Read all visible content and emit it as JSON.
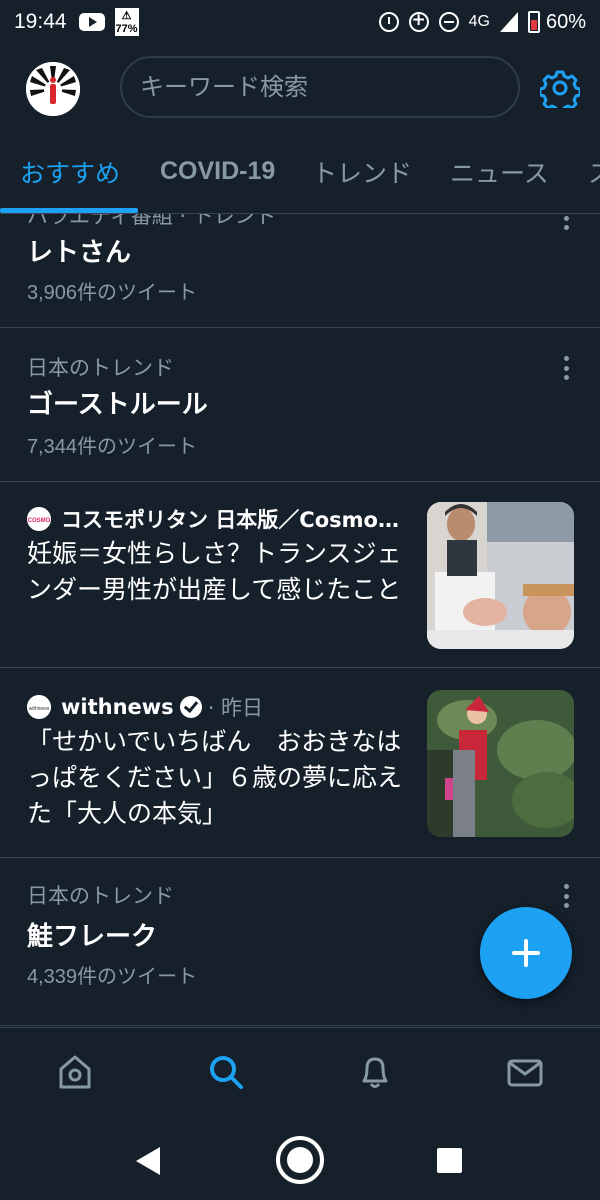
{
  "status_bar": {
    "time": "19:44",
    "sd_badge_top": "⚠",
    "sd_badge_pct": "77%",
    "network": "4G",
    "battery_pct": "60%"
  },
  "header": {
    "search_placeholder": "キーワード検索"
  },
  "tabs": [
    {
      "label": "おすすめ",
      "active": true
    },
    {
      "label": "COVID-19",
      "active": false
    },
    {
      "label": "トレンド",
      "active": false
    },
    {
      "label": "ニュース",
      "active": false
    },
    {
      "label": "ス",
      "active": false
    }
  ],
  "feed": {
    "trend1": {
      "context": "バラエティ番組 · トレンド",
      "topic": "レトさん",
      "count": "3,906件のツイート"
    },
    "trend2": {
      "context": "日本のトレンド",
      "topic": "ゴーストルール",
      "count": "7,344件のツイート"
    },
    "news1": {
      "source": "コスモポリタン 日本版／Cosmop...",
      "logo_text": "COSMO",
      "headline": "妊娠＝女性らしさ？トランスジェンダー男性が出産して感じたこと"
    },
    "news2": {
      "source": "withnews",
      "logo_text": "withnews",
      "time": "· 昨日",
      "headline": "「せかいでいちばん　おおきなはっぱをください」６歳の夢に応えた「大人の本気」"
    },
    "trend3": {
      "context": "日本のトレンド",
      "topic": "鮭フレーク",
      "count": "4,339件のツイート"
    }
  },
  "colors": {
    "background": "#15202b",
    "accent": "#1da1f2",
    "muted_text": "#8899a6",
    "divider": "#38444d"
  },
  "icons": {
    "header": [
      "app-avatar",
      "gear-icon"
    ],
    "bottom_nav": [
      "home-icon",
      "search-icon",
      "bell-icon",
      "mail-icon"
    ],
    "system_nav": [
      "back",
      "home",
      "recents"
    ]
  }
}
